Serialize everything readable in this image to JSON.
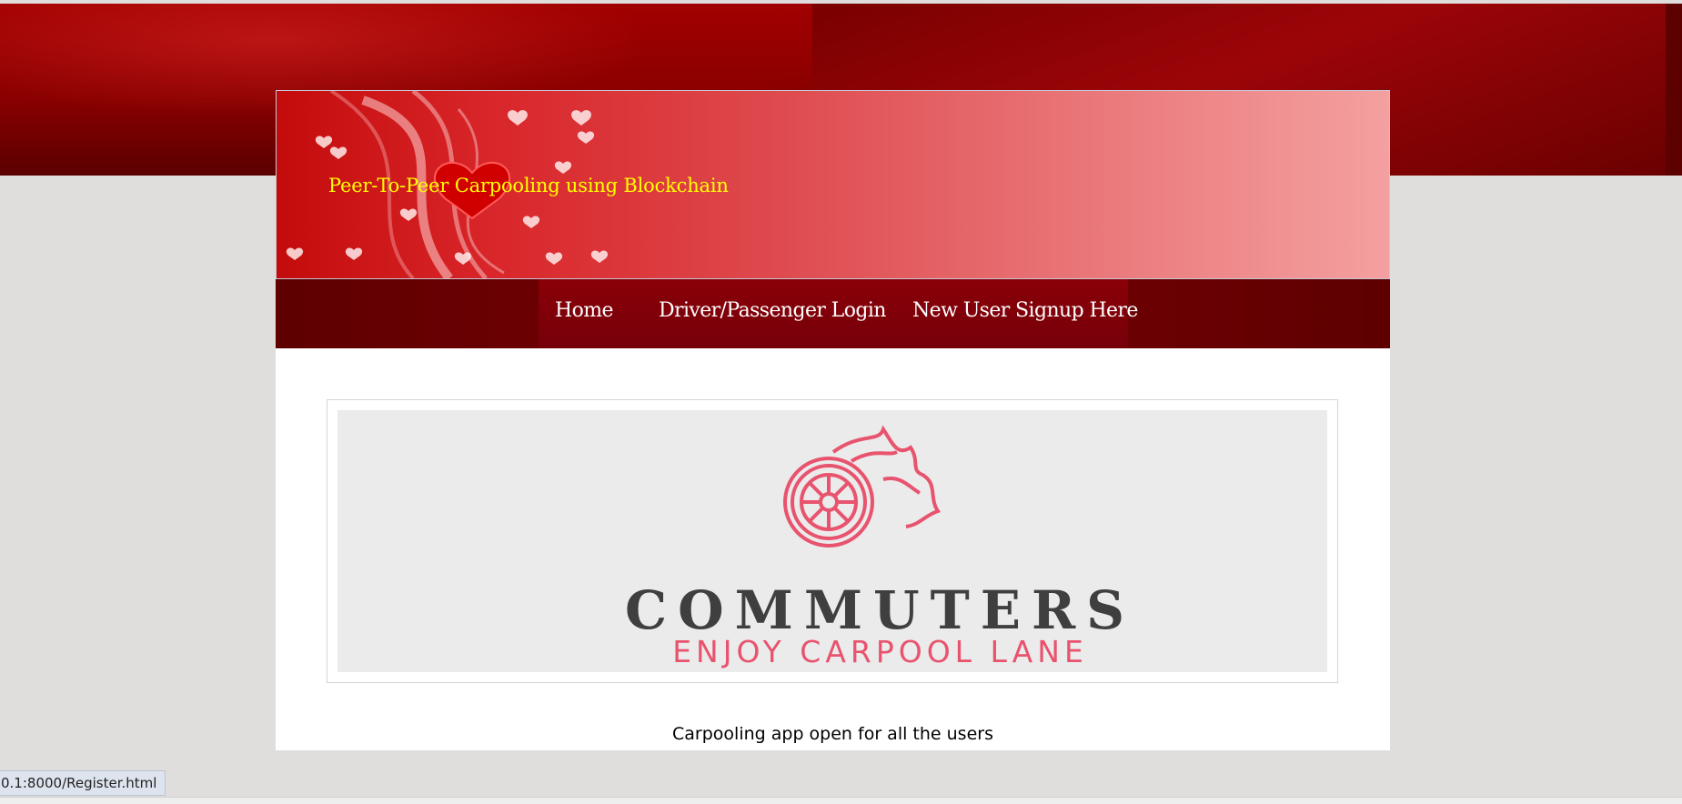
{
  "header": {
    "site_title": "Peer-To-Peer Carpooling using Blockchain"
  },
  "nav": {
    "items": [
      {
        "label": "Home"
      },
      {
        "label": "Driver/Passenger Login"
      },
      {
        "label": "New User Signup Here"
      }
    ]
  },
  "main": {
    "logo": {
      "brand": "COMMUTERS",
      "tagline": "ENJOY CARPOOL LANE",
      "icon": "flaming-wheel-icon"
    },
    "caption": "Carpooling app open for all the users"
  },
  "status_bar": {
    "url": "0.1:8000/Register.html"
  },
  "colors": {
    "title_yellow": "#ffff00",
    "nav_dark_red": "#7a0005",
    "logo_pink": "#e8536e"
  }
}
